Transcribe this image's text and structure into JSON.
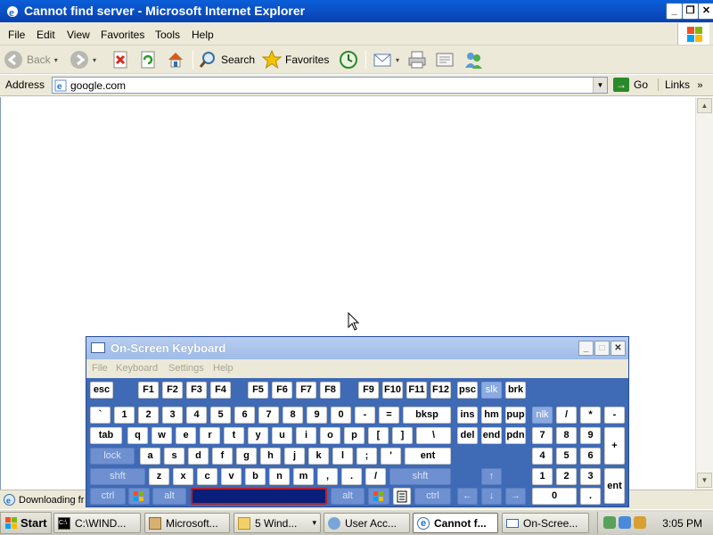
{
  "window": {
    "title": "Cannot find server - Microsoft Internet Explorer",
    "minimize": "_",
    "restore": "❐",
    "close": "✕"
  },
  "menu": {
    "items": [
      "File",
      "Edit",
      "View",
      "Favorites",
      "Tools",
      "Help"
    ]
  },
  "toolbar": {
    "back_label": "Back",
    "search_label": "Search",
    "favorites_label": "Favorites"
  },
  "address": {
    "label": "Address",
    "value": "google.com",
    "go_label": "Go",
    "links_label": "Links",
    "links_chevron": "»"
  },
  "status": {
    "text": "Downloading fr"
  },
  "osk": {
    "title": "On-Screen Keyboard",
    "menu": [
      "File",
      "Keyboard",
      "Settings",
      "Help"
    ],
    "keys": {
      "esc": "esc",
      "f1": "F1",
      "f2": "F2",
      "f3": "F3",
      "f4": "F4",
      "f5": "F5",
      "f6": "F6",
      "f7": "F7",
      "f8": "F8",
      "f9": "F9",
      "f10": "F10",
      "f11": "F11",
      "f12": "F12",
      "psc": "psc",
      "slk": "slk",
      "brk": "brk",
      "backtick": "`",
      "k1": "1",
      "k2": "2",
      "k3": "3",
      "k4": "4",
      "k5": "5",
      "k6": "6",
      "k7": "7",
      "k8": "8",
      "k9": "9",
      "k0": "0",
      "minus": "-",
      "equals": "=",
      "bksp": "bksp",
      "ins": "ins",
      "hm": "hm",
      "pup": "pup",
      "nlk": "nlk",
      "slash": "/",
      "star": "*",
      "npminus": "-",
      "tab": "tab",
      "q": "q",
      "w": "w",
      "e": "e",
      "r": "r",
      "t": "t",
      "y": "y",
      "u": "u",
      "i": "i",
      "o": "o",
      "p": "p",
      "lbr": "[",
      "rbr": "]",
      "bslash": "\\",
      "del": "del",
      "end": "end",
      "pdn": "pdn",
      "np7": "7",
      "np8": "8",
      "np9": "9",
      "plus": "+",
      "lock": "lock",
      "a": "a",
      "s": "s",
      "d": "d",
      "f": "f",
      "g": "g",
      "h": "h",
      "j": "j",
      "k": "k",
      "l": "l",
      "semi": ";",
      "quote": "'",
      "ent": "ent",
      "np4": "4",
      "np5": "5",
      "np6": "6",
      "shft": "shft",
      "z": "z",
      "x": "x",
      "c": "c",
      "v": "v",
      "b": "b",
      "n": "n",
      "m": "m",
      "comma": ",",
      "period": ".",
      "fslash": "/",
      "rshft": "shft",
      "up": "↑",
      "np1": "1",
      "np2": "2",
      "np3": "3",
      "npent": "ent",
      "ctrl": "ctrl",
      "alt": "alt",
      "ralt": "alt",
      "rctrl": "ctrl",
      "left": "←",
      "down": "↓",
      "right": "→",
      "np0": "0",
      "npdot": "."
    }
  },
  "taskbar": {
    "start": "Start",
    "tasks": [
      "C:\\WIND...",
      "Microsoft...",
      "5 Wind...",
      "User Acc...",
      "Cannot f...",
      "On-Scree..."
    ],
    "group_arrow": "▾",
    "clock": "3:05 PM"
  },
  "colors": {
    "title_blue": "#0a4fc4",
    "osk_blue": "#3f6ab5",
    "osk_mod_key": "#6e90d0",
    "spacebar": "#0a1f7a"
  }
}
